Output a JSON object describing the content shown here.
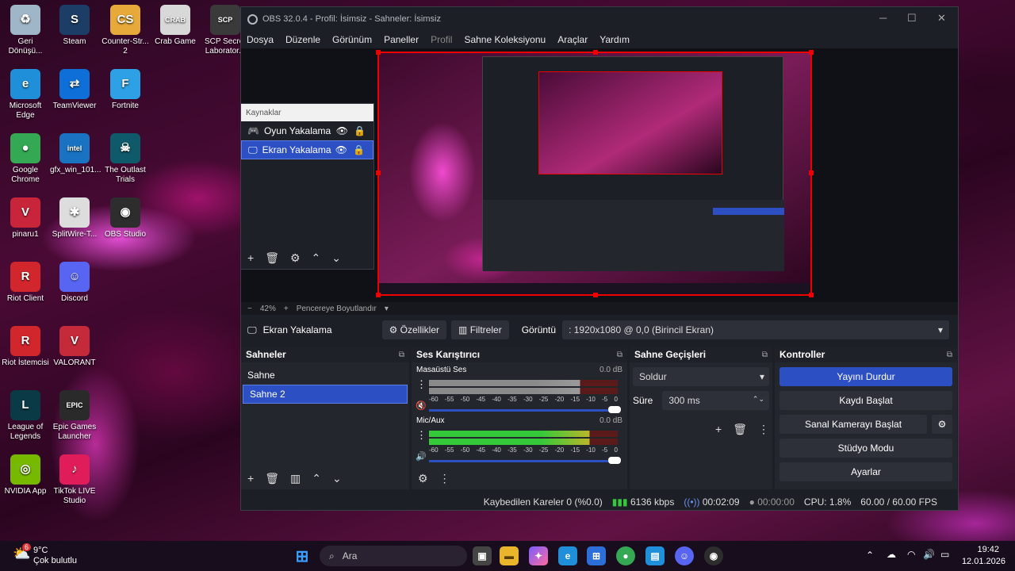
{
  "desktop": {
    "icons": [
      {
        "label": "Geri\nDönüşü...",
        "icon": "recycle-bin-icon",
        "color": "#9fb6c9",
        "glyph": "♻"
      },
      {
        "label": "Steam",
        "icon": "steam-icon",
        "color": "#1b3d66",
        "glyph": "S"
      },
      {
        "label": "Counter-Str...\n2",
        "icon": "counter-strike-icon",
        "color": "#e7a93a",
        "glyph": "CS"
      },
      {
        "label": "Crab Game",
        "icon": "crab-game-icon",
        "color": "#d8d8d8",
        "glyph": "CRAB"
      },
      {
        "label": "SCP Secret\nLaborator...",
        "icon": "scp-icon",
        "color": "#3a3a3a",
        "glyph": "SCP"
      },
      {
        "label": "Microsoft\nEdge",
        "icon": "edge-icon",
        "color": "#1e8fd8",
        "glyph": "e"
      },
      {
        "label": "TeamViewer",
        "icon": "teamviewer-icon",
        "color": "#0e6fd8",
        "glyph": "⇄"
      },
      {
        "label": "Fortnite",
        "icon": "fortnite-icon",
        "color": "#2ea0e6",
        "glyph": "F"
      },
      {
        "label": "Google\nChrome",
        "icon": "chrome-icon",
        "color": "#34a853",
        "glyph": "●"
      },
      {
        "label": "gfx_win_101...",
        "icon": "intel-icon",
        "color": "#1a73c2",
        "glyph": "intel"
      },
      {
        "label": "The Outlast\nTrials",
        "icon": "outlast-icon",
        "color": "#0f5a6a",
        "glyph": "☠"
      },
      {
        "label": "pinaru1",
        "icon": "valorant-shortcut-icon",
        "color": "#c9253a",
        "glyph": "V"
      },
      {
        "label": "SplitWire-T...",
        "icon": "splitwire-icon",
        "color": "#ddd",
        "glyph": "✱"
      },
      {
        "label": "OBS Studio",
        "icon": "obs-icon",
        "color": "#2d2d2d",
        "glyph": "◉"
      },
      {
        "label": "Riot Client",
        "icon": "riot-client-icon",
        "color": "#d0262c",
        "glyph": "R"
      },
      {
        "label": "Discord",
        "icon": "discord-icon",
        "color": "#5865f2",
        "glyph": "☺"
      },
      {
        "label": "Riot İstemcisi",
        "icon": "riot-istemcisi-icon",
        "color": "#d0262c",
        "glyph": "R"
      },
      {
        "label": "VALORANT",
        "icon": "valorant-icon",
        "color": "#c42a3a",
        "glyph": "V"
      },
      {
        "label": "League of\nLegends",
        "icon": "league-icon",
        "color": "#0a3a46",
        "glyph": "L"
      },
      {
        "label": "Epic Games\nLauncher",
        "icon": "epic-icon",
        "color": "#2a2a2a",
        "glyph": "EPIC"
      },
      {
        "label": "NVIDIA App",
        "icon": "nvidia-icon",
        "color": "#76b900",
        "glyph": "◎"
      },
      {
        "label": "TikTok LIVE\nStudio",
        "icon": "tiktok-icon",
        "color": "#e01d5a",
        "glyph": "♪"
      }
    ]
  },
  "obs": {
    "title": "OBS 32.0.4 - Profil: İsimsiz - Sahneler: İsimsiz",
    "menu": [
      "Dosya",
      "Düzenle",
      "Görünüm",
      "Paneller",
      "Profil",
      "Sahne Koleksiyonu",
      "Araçlar",
      "Yardım"
    ],
    "sources": {
      "header": "Kaynaklar",
      "items": [
        {
          "label": "Oyun Yakalama"
        },
        {
          "label": "Ekran Yakalama"
        }
      ]
    },
    "zoom": {
      "minus": "−",
      "value": "42%",
      "plus": "+",
      "fit": "Pencereye Boyutlandır"
    },
    "context": {
      "source": "Ekran Yakalama",
      "properties": "Özellikler",
      "filters": "Filtreler",
      "display_label": "Görüntü",
      "display_value": ": 1920x1080 @ 0,0 (Birincil Ekran)"
    },
    "scenes": {
      "title": "Sahneler",
      "items": [
        "Sahne",
        "Sahne 2"
      ]
    },
    "mixer": {
      "title": "Ses Karıştırıcı",
      "channels": [
        {
          "name": "Masaüstü Ses",
          "db": "0.0 dB",
          "level": 0.8,
          "muted": true
        },
        {
          "name": "Mic/Aux",
          "db": "0.0 dB",
          "level": 0.85,
          "muted": false
        }
      ],
      "ticks": [
        "-60",
        "-55",
        "-50",
        "-45",
        "-40",
        "-35",
        "-30",
        "-25",
        "-20",
        "-15",
        "-10",
        "-5",
        "0"
      ]
    },
    "transitions": {
      "title": "Sahne Geçişleri",
      "type": "Soldur",
      "duration_label": "Süre",
      "duration": "300 ms"
    },
    "controls": {
      "title": "Kontroller",
      "buttons": [
        "Yayını Durdur",
        "Kaydı Başlat",
        "Sanal Kamerayı Başlat",
        "Stüdyo Modu",
        "Ayarlar"
      ]
    },
    "status": {
      "dropped": "Kaybedilen Kareler 0 (%0.0)",
      "bitrate": "6136 kbps",
      "stream_time": "00:02:09",
      "rec_time": "00:00:00",
      "cpu": "CPU: 1.8%",
      "fps": "60.00 / 60.00 FPS"
    },
    "colors": {
      "accent": "#2c4fc4",
      "red_border": "#e00000",
      "meter_green": "#35c93a"
    }
  },
  "taskbar": {
    "weather_temp": "9°C",
    "weather_desc": "Çok bulutlu",
    "weather_badge": "6",
    "search": "Ara",
    "time": "19:42",
    "date": "12.01.2026"
  }
}
